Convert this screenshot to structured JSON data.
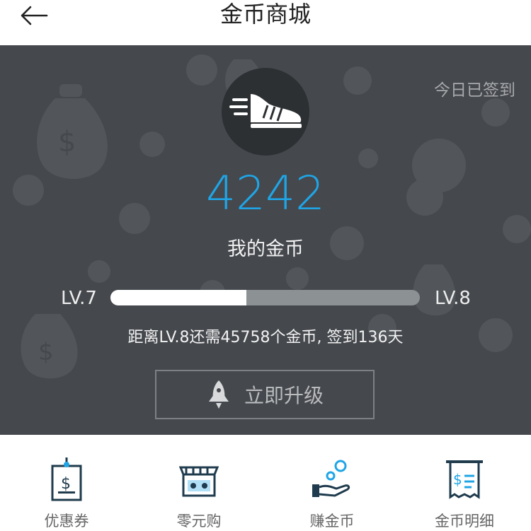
{
  "header": {
    "title": "金币商城",
    "back_icon": "arrow-left-icon"
  },
  "profile": {
    "avatar_icon": "sneaker-icon",
    "signed_text": "今日已签到",
    "coins_value": "4242",
    "coins_label": "我的金币",
    "level_current": "LV.7",
    "level_next": "LV.8",
    "level_progress_fraction": 0.44,
    "level_info": "距离LV.8还需45758个金币, 签到136天",
    "upgrade_label": "立即升级",
    "upgrade_icon": "rocket-icon"
  },
  "colors": {
    "accent": "#1fa5e6",
    "panel_bg": "#45484d"
  },
  "bottom_nav": [
    {
      "label": "优惠券",
      "icon": "coupon-icon"
    },
    {
      "label": "零元购",
      "icon": "shop-icon"
    },
    {
      "label": "赚金币",
      "icon": "earn-coins-icon"
    },
    {
      "label": "金币明细",
      "icon": "receipt-icon"
    }
  ]
}
